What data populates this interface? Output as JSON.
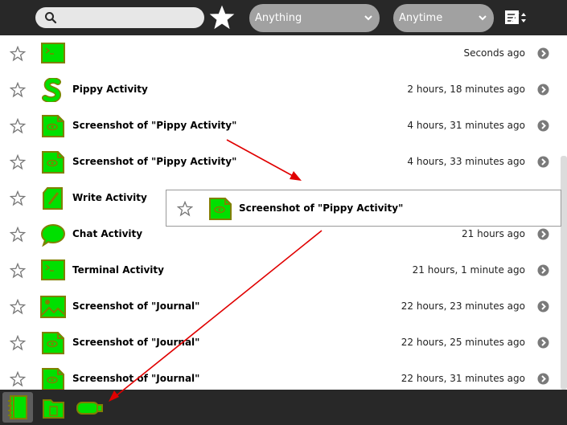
{
  "toolbar": {
    "search_placeholder": "",
    "filter_what": "Anything",
    "filter_when": "Anytime"
  },
  "entries": [
    {
      "title": "",
      "date": "Seconds ago",
      "icon": "terminal-icon"
    },
    {
      "title": "Pippy Activity",
      "date": "2 hours, 18 minutes ago",
      "icon": "pippy-snake-icon"
    },
    {
      "title": "Screenshot of \"Pippy Activity\"",
      "date": "4 hours, 31 minutes ago",
      "icon": "image-file-icon"
    },
    {
      "title": "Screenshot of \"Pippy Activity\"",
      "date": "4 hours, 33 minutes ago",
      "icon": "image-file-icon"
    },
    {
      "title": "Write Activity",
      "date": "",
      "icon": "write-document-icon"
    },
    {
      "title": "Chat Activity",
      "date": "21 hours ago",
      "icon": "chat-bubble-icon"
    },
    {
      "title": "Terminal Activity",
      "date": "21 hours, 1 minute ago",
      "icon": "terminal-icon"
    },
    {
      "title": "Screenshot of \"Journal\"",
      "date": "22 hours, 23 minutes ago",
      "icon": "landscape-image-icon"
    },
    {
      "title": "Screenshot of \"Journal\"",
      "date": "22 hours, 25 minutes ago",
      "icon": "image-file-icon"
    },
    {
      "title": "Screenshot of \"Journal\"",
      "date": "22 hours, 31 minutes ago",
      "icon": "image-file-icon"
    }
  ],
  "drag_preview": {
    "title": "Screenshot of \"Pippy Activity\""
  },
  "tray": [
    {
      "name": "journal-tray-icon",
      "active": true
    },
    {
      "name": "documents-folder-tray-icon",
      "active": false
    },
    {
      "name": "usb-drive-tray-icon",
      "active": false
    }
  ],
  "colors": {
    "icon_fill": "#00e000",
    "icon_stroke": "#808000",
    "toolbar_bg": "#282828",
    "annotation_arrow": "#e00000"
  }
}
